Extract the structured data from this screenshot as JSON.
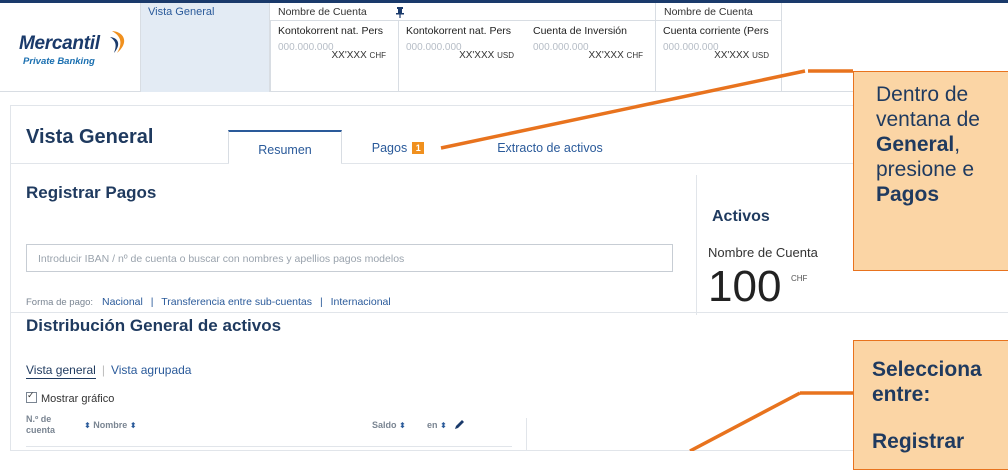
{
  "brand": {
    "name": "Mercantil",
    "sub": "Private Banking",
    "colors": {
      "navy": "#1a3a6b",
      "accent": "#f0901e",
      "callout_bg": "#fbd5a5",
      "callout_border": "#e8731e"
    }
  },
  "header": {
    "nav_active": "Vista General",
    "account_head_1": "Nombre de Cuenta",
    "account_head_2": "Nombre de Cuenta",
    "accounts": [
      {
        "name": "Kontokorrent nat. Pers",
        "number": "000.000.000",
        "amount": "XX'XXX",
        "currency": "CHF"
      },
      {
        "name": "Kontokorrent nat. Pers",
        "number": "000.000.000",
        "amount": "XX'XXX",
        "currency": "USD"
      },
      {
        "name": "Cuenta de Inversión",
        "number": "000.000.000",
        "amount": "XX'XXX",
        "currency": "CHF"
      },
      {
        "name": "Cuenta corriente (Pers",
        "number": "000.000.000",
        "amount": "XX'XXX",
        "currency": "USD"
      }
    ]
  },
  "main": {
    "title": "Vista General",
    "tabs": [
      {
        "label": "Resumen",
        "active": true
      },
      {
        "label": "Pagos",
        "badge": "1"
      },
      {
        "label": "Extracto de activos"
      }
    ],
    "payments": {
      "title": "Registrar Pagos",
      "search_placeholder": "Introducir IBAN / nº de cuenta o buscar con nombres y apellios pagos modelos",
      "form_label": "Forma de pago:",
      "options": [
        "Nacional",
        "Transferencia entre sub-cuentas",
        "Internacional"
      ],
      "separators": [
        "|",
        "|"
      ]
    },
    "assets": {
      "title": "Activos",
      "account_label": "Nombre de Cuenta",
      "value": "100",
      "currency": "CHF"
    },
    "distribution": {
      "title": "Distribución General de activos",
      "views": [
        "Vista general",
        "Vista agrupada"
      ],
      "view_separator": "|",
      "show_chart": "Mostrar gráfico",
      "columns": {
        "account_no": "N.º de cuenta",
        "name": "Nombre",
        "balance": "Saldo",
        "in": "en"
      }
    }
  },
  "callouts": {
    "first": {
      "line1": "Dentro de",
      "line2": "ventana de",
      "bold1": "General",
      "comma": ",",
      "line3": "presione e",
      "bold2": "Pagos"
    },
    "second": {
      "line1": "Selecciona",
      "line2": "entre:",
      "line3": "Registrar"
    }
  }
}
